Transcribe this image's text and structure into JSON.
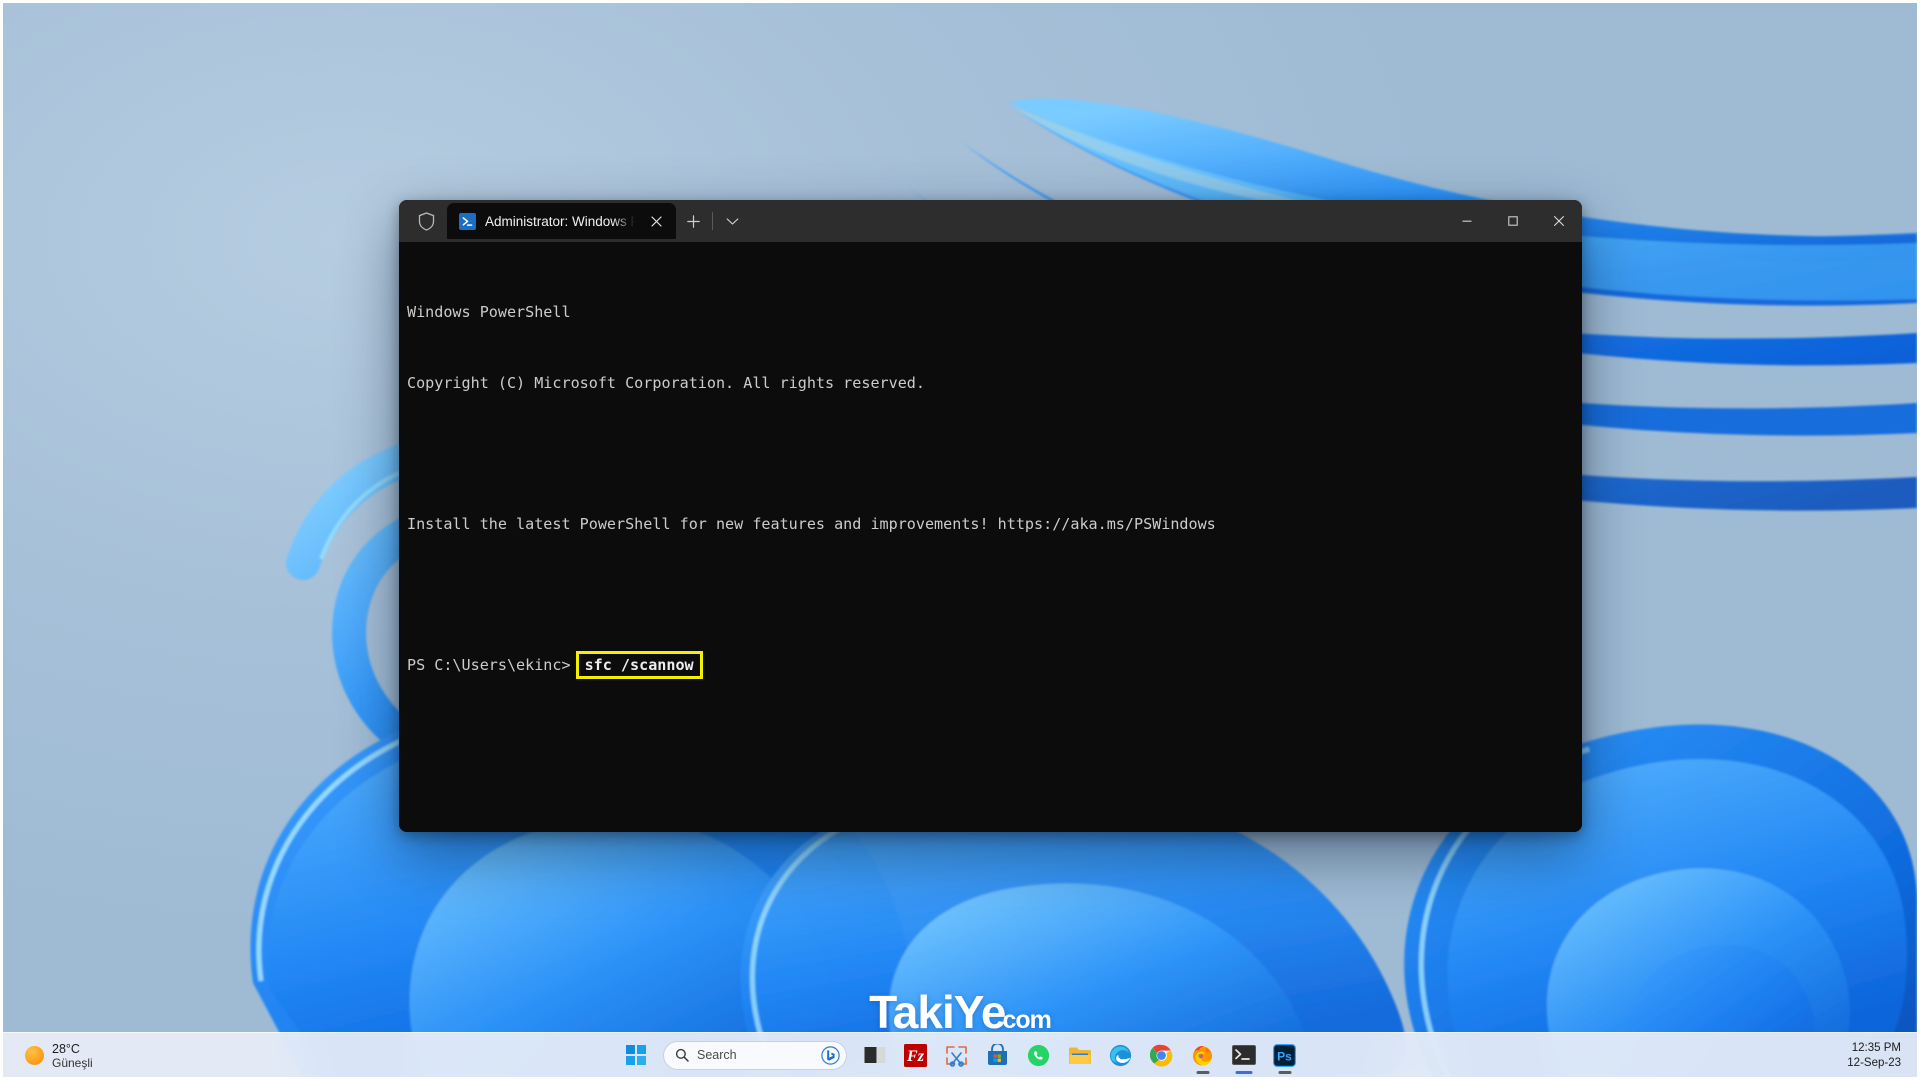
{
  "desktop": {
    "wallpaper_name": "windows-11-bloom-wallpaper",
    "background_color": "#a6c0d8",
    "accent_blue": "#1f7ef0"
  },
  "watermark": {
    "main": "TakiYe",
    "sub": "com"
  },
  "terminal": {
    "titlebar": {
      "shield_icon": "shield-icon",
      "tab": {
        "icon": "powershell-icon",
        "title": "Administrator: Windows Powe",
        "close_icon": "close-icon"
      },
      "new_tab_icon": "plus-icon",
      "dropdown_icon": "chevron-down-icon",
      "minimize_icon": "minimize-icon",
      "maximize_icon": "maximize-icon",
      "close_icon": "close-icon"
    },
    "lines": [
      "Windows PowerShell",
      "Copyright (C) Microsoft Corporation. All rights reserved.",
      "",
      "Install the latest PowerShell for new features and improvements! https://aka.ms/PSWindows",
      ""
    ],
    "prompt": "PS C:\\Users\\ekinc>",
    "command": "sfc /scannow",
    "highlight_color": "#f5f000",
    "background_color": "#0c0c0c",
    "text_color": "#cccccc"
  },
  "taskbar": {
    "weather": {
      "temperature": "28°C",
      "condition": "Güneşli",
      "icon": "sun-icon"
    },
    "search": {
      "icon": "search-icon",
      "placeholder": "Search",
      "assistant_icon": "bing-copilot-icon"
    },
    "start_icon": "windows-start-icon",
    "apps": [
      {
        "name": "task-view-icon",
        "label": "Task View"
      },
      {
        "name": "filezilla-icon",
        "label": "FileZilla"
      },
      {
        "name": "snipping-tool-icon",
        "label": "Snipping Tool"
      },
      {
        "name": "microsoft-store-icon",
        "label": "Microsoft Store"
      },
      {
        "name": "whatsapp-icon",
        "label": "WhatsApp"
      },
      {
        "name": "file-explorer-icon",
        "label": "File Explorer"
      },
      {
        "name": "microsoft-edge-icon",
        "label": "Microsoft Edge"
      },
      {
        "name": "google-chrome-icon",
        "label": "Google Chrome"
      },
      {
        "name": "firefox-icon",
        "label": "Mozilla Firefox"
      },
      {
        "name": "windows-terminal-icon",
        "label": "Windows Terminal"
      },
      {
        "name": "photoshop-icon",
        "label": "Adobe Photoshop"
      }
    ],
    "clock": {
      "time": "12:35 PM",
      "date": "12-Sep-23"
    }
  }
}
